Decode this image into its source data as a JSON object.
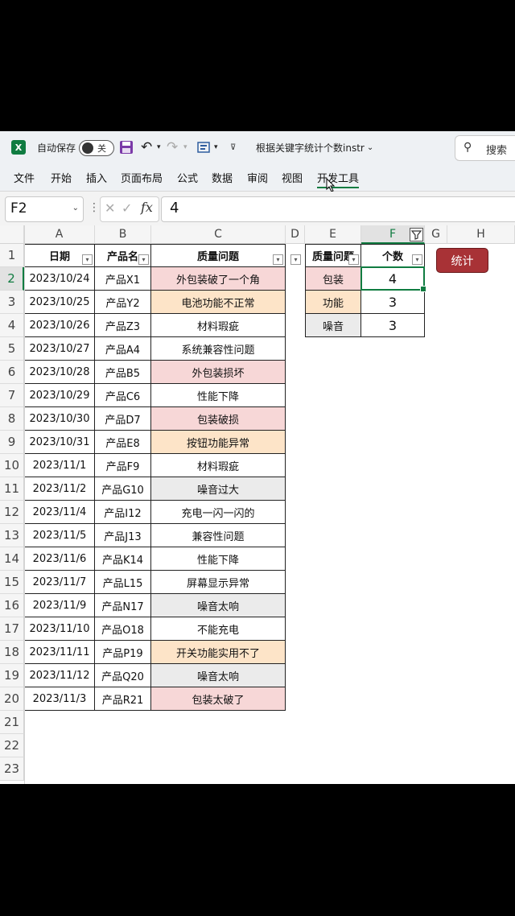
{
  "window": {
    "autosave_label": "自动保存",
    "autosave_state": "关",
    "doc_title": "根据关键字统计个数instr",
    "search_placeholder": "搜索"
  },
  "ribbon": {
    "tabs": [
      "文件",
      "开始",
      "插入",
      "页面布局",
      "公式",
      "数据",
      "审阅",
      "视图",
      "开发工具"
    ]
  },
  "formula_bar": {
    "name_box": "F2",
    "formula": "4"
  },
  "columns": [
    "A",
    "B",
    "C",
    "D",
    "E",
    "F",
    "G",
    "H"
  ],
  "rows": [
    "1",
    "2",
    "3",
    "4",
    "5",
    "6",
    "7",
    "8",
    "9",
    "10",
    "11",
    "12",
    "13",
    "14",
    "15",
    "16",
    "17",
    "18",
    "19",
    "20",
    "21",
    "22",
    "23"
  ],
  "table1": {
    "headers": [
      "日期",
      "产品名",
      "质量问题"
    ],
    "rows": [
      [
        "2023/10/24",
        "产品X1",
        "外包装破了一个角"
      ],
      [
        "2023/10/25",
        "产品Y2",
        "电池功能不正常"
      ],
      [
        "2023/10/26",
        "产品Z3",
        "材料瑕疵"
      ],
      [
        "2023/10/27",
        "产品A4",
        "系统兼容性问题"
      ],
      [
        "2023/10/28",
        "产品B5",
        "外包装损坏"
      ],
      [
        "2023/10/29",
        "产品C6",
        "性能下降"
      ],
      [
        "2023/10/30",
        "产品D7",
        "包装破损"
      ],
      [
        "2023/10/31",
        "产品E8",
        "按钮功能异常"
      ],
      [
        "2023/11/1",
        "产品F9",
        "材料瑕疵"
      ],
      [
        "2023/11/2",
        "产品G10",
        "噪音过大"
      ],
      [
        "2023/11/4",
        "产品I12",
        "充电一闪一闪的"
      ],
      [
        "2023/11/5",
        "产品J13",
        "兼容性问题"
      ],
      [
        "2023/11/6",
        "产品K14",
        "性能下降"
      ],
      [
        "2023/11/7",
        "产品L15",
        "屏幕显示异常"
      ],
      [
        "2023/11/9",
        "产品N17",
        "噪音太响"
      ],
      [
        "2023/11/10",
        "产品O18",
        "不能充电"
      ],
      [
        "2023/11/11",
        "产品P19",
        "开关功能实用不了"
      ],
      [
        "2023/11/12",
        "产品Q20",
        "噪音太响"
      ],
      [
        "2023/11/3",
        "产品R21",
        "包装太破了"
      ]
    ],
    "fills": [
      "pink",
      "peach",
      "white",
      "white",
      "pink",
      "white",
      "pink",
      "peach",
      "white",
      "gray",
      "white",
      "white",
      "white",
      "white",
      "gray",
      "white",
      "peach",
      "gray",
      "pink"
    ]
  },
  "table2": {
    "headers": [
      "质量问题",
      "个数"
    ],
    "rows": [
      [
        "包装",
        "4"
      ],
      [
        "功能",
        "3"
      ],
      [
        "噪音",
        "3"
      ]
    ],
    "fills": [
      "pink",
      "peach",
      "gray"
    ]
  },
  "colors": {
    "pink": "#f7d7d7",
    "peach": "#fde4c8",
    "gray": "#ebebeb",
    "white": "#ffffff",
    "accent": "#107c41",
    "button": "#a83236"
  },
  "stat_button": "统计"
}
